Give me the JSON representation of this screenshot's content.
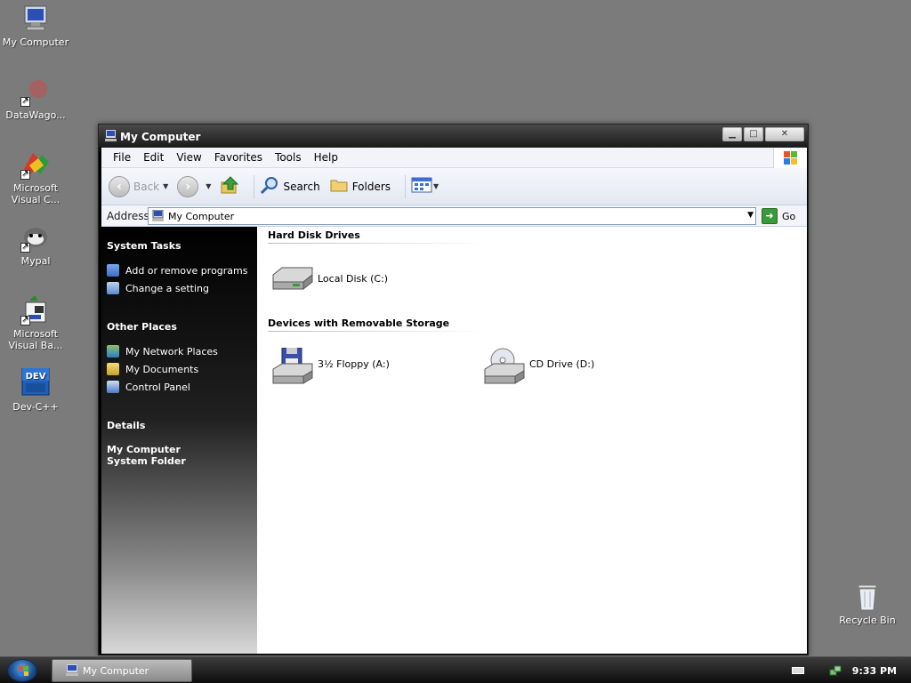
{
  "desktop": {
    "icons": [
      {
        "label": "My Computer",
        "icon": "my-computer-icon"
      },
      {
        "label": "DataWago...",
        "icon": "datawagon-icon"
      },
      {
        "label": "Microsoft Visual C...",
        "icon": "visual-c-icon"
      },
      {
        "label": "Mypal",
        "icon": "mypal-icon"
      },
      {
        "label": "Microsoft Visual Ba...",
        "icon": "visual-basic-icon"
      },
      {
        "label": "Dev-C++",
        "icon": "devcpp-icon"
      }
    ],
    "recycle_bin": "Recycle Bin"
  },
  "window": {
    "title": "My Computer",
    "controls": {
      "minimize": "▁",
      "maximize": "□",
      "close": "✕"
    },
    "menu": [
      "File",
      "Edit",
      "View",
      "Favorites",
      "Tools",
      "Help"
    ],
    "toolbar": {
      "back": "Back",
      "search": "Search",
      "folders": "Folders"
    },
    "address": {
      "label": "Address",
      "value": "My Computer",
      "go": "Go"
    }
  },
  "taskpane": {
    "system_tasks": {
      "title": "System Tasks",
      "items": [
        "Add or remove programs",
        "Change a setting"
      ]
    },
    "other_places": {
      "title": "Other Places",
      "items": [
        "My Network Places",
        "My Documents",
        "Control Panel"
      ]
    },
    "details": {
      "title": "Details",
      "name": "My Computer",
      "type": "System Folder"
    }
  },
  "content": {
    "groups": [
      {
        "title": "Hard Disk Drives",
        "items": [
          "Local Disk (C:)"
        ]
      },
      {
        "title": "Devices with Removable Storage",
        "items": [
          "3½ Floppy (A:)",
          "CD Drive (D:)"
        ]
      }
    ]
  },
  "taskbar": {
    "task": "My Computer",
    "clock": "9:33 PM"
  }
}
